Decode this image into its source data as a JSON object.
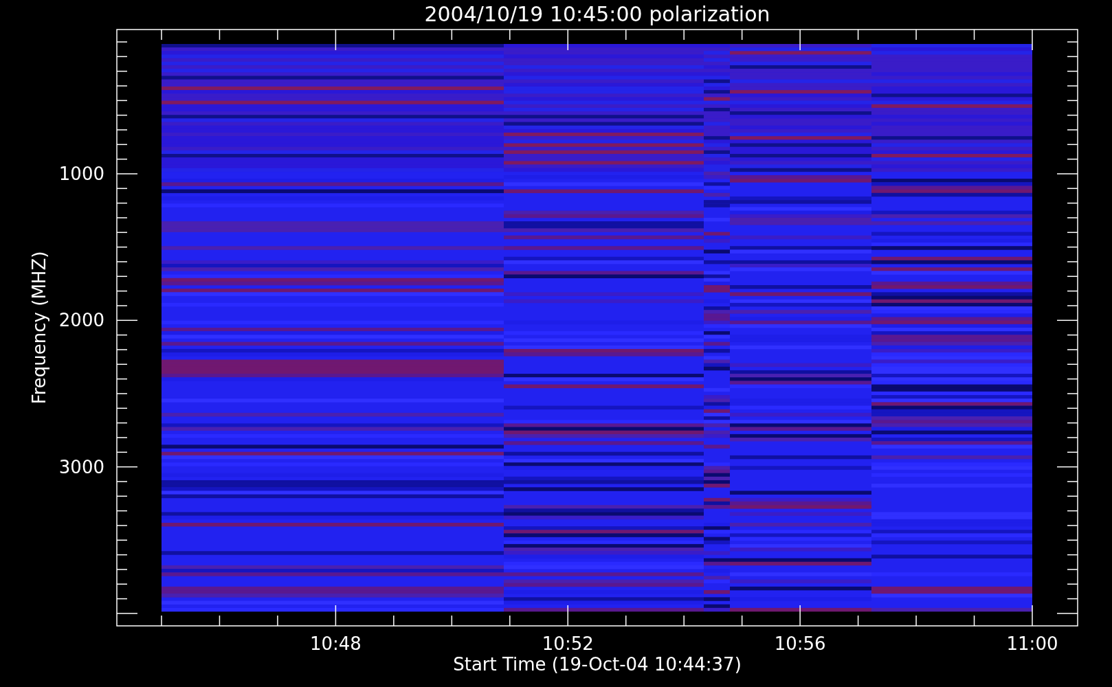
{
  "title": "2004/10/19 10:45:00 polarization",
  "y_axis": {
    "label": "Frequency (MHZ)",
    "ticks": [
      "1000",
      "2000",
      "3000"
    ]
  },
  "x_axis": {
    "label": "Start Time (19-Oct-04 10:44:37)",
    "ticks": [
      "10:48",
      "10:52",
      "10:56",
      "11:00"
    ]
  }
}
